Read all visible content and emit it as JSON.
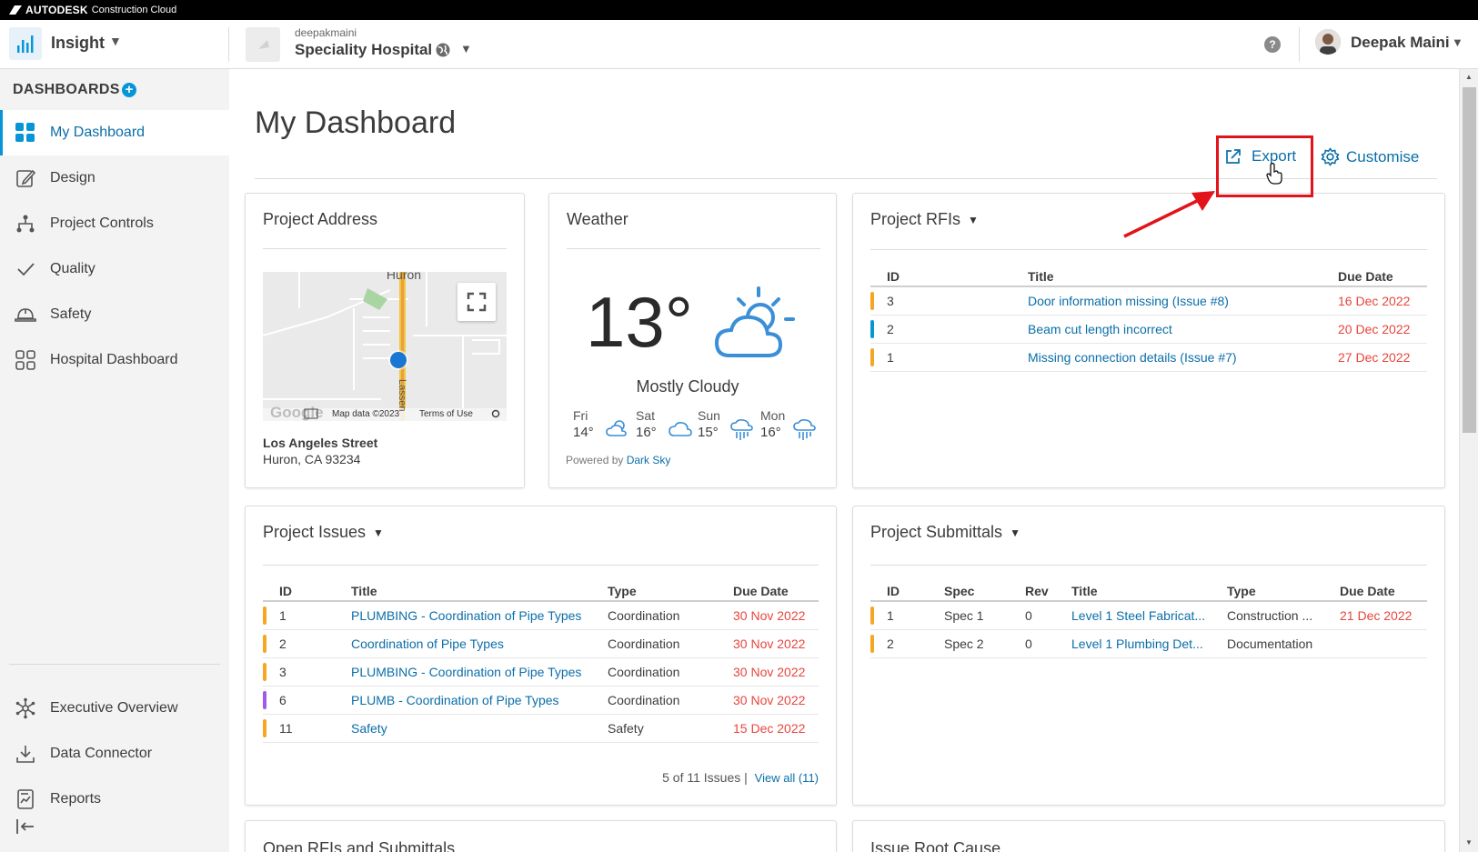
{
  "brand": {
    "name": "AUTODESK",
    "product": "Construction Cloud"
  },
  "header": {
    "app_name": "Insight",
    "account": "deepakmaini",
    "project": "Speciality Hospital",
    "user": "Deepak Maini"
  },
  "sidebar": {
    "title": "DASHBOARDS",
    "items": [
      {
        "label": "My Dashboard",
        "icon": "grid-icon",
        "active": true
      },
      {
        "label": "Design",
        "icon": "edit-icon"
      },
      {
        "label": "Project Controls",
        "icon": "hierarchy-icon"
      },
      {
        "label": "Quality",
        "icon": "checkmark-icon"
      },
      {
        "label": "Safety",
        "icon": "hardhat-icon"
      },
      {
        "label": "Hospital Dashboard",
        "icon": "grid-outline-icon"
      }
    ],
    "bottom_items": [
      {
        "label": "Executive Overview",
        "icon": "network-icon"
      },
      {
        "label": "Data Connector",
        "icon": "download-icon"
      },
      {
        "label": "Reports",
        "icon": "report-icon"
      }
    ]
  },
  "main": {
    "title": "My Dashboard",
    "export_label": "Export",
    "customise_label": "Customise"
  },
  "address_card": {
    "title": "Project Address",
    "street": "Los Angeles Street",
    "city": "Huron, CA 93234",
    "map_label_top": "Huron",
    "map_street": "Lassen",
    "map_data": "Map data ©2023",
    "terms": "Terms of Use",
    "google": "Google"
  },
  "weather_card": {
    "title": "Weather",
    "temp": "13°",
    "condition": "Mostly Cloudy",
    "forecast": [
      {
        "day": "Fri",
        "temp": "14°",
        "icon": "partly-cloudy-icon"
      },
      {
        "day": "Sat",
        "temp": "16°",
        "icon": "cloud-icon"
      },
      {
        "day": "Sun",
        "temp": "15°",
        "icon": "rain-icon"
      },
      {
        "day": "Mon",
        "temp": "16°",
        "icon": "rain-icon"
      }
    ],
    "powered_by": "Powered by",
    "powered_link": "Dark Sky"
  },
  "rfis_card": {
    "title": "Project RFIs",
    "columns": [
      "ID",
      "Title",
      "Due Date"
    ],
    "rows": [
      {
        "id": "3",
        "title": "Door information missing (Issue #8)",
        "due": "16 Dec 2022",
        "flag": "#f5a623"
      },
      {
        "id": "2",
        "title": "Beam cut length incorrect",
        "due": "20 Dec 2022",
        "flag": "#0696d7"
      },
      {
        "id": "1",
        "title": "Missing connection details (Issue #7)",
        "due": "27 Dec 2022",
        "flag": "#f5a623"
      }
    ]
  },
  "issues_card": {
    "title": "Project Issues",
    "columns": [
      "ID",
      "Title",
      "Type",
      "Due Date"
    ],
    "rows": [
      {
        "id": "1",
        "title": "PLUMBING - Coordination of Pipe Types",
        "type": "Coordination",
        "due": "30 Nov 2022",
        "flag": "#f5a623"
      },
      {
        "id": "2",
        "title": "Coordination of Pipe Types",
        "type": "Coordination",
        "due": "30 Nov 2022",
        "flag": "#f5a623"
      },
      {
        "id": "3",
        "title": "PLUMBING - Coordination of Pipe Types",
        "type": "Coordination",
        "due": "30 Nov 2022",
        "flag": "#f5a623"
      },
      {
        "id": "6",
        "title": "PLUMB - Coordination of Pipe Types",
        "type": "Coordination",
        "due": "30 Nov 2022",
        "flag": "#a05ce8"
      },
      {
        "id": "11",
        "title": "Safety",
        "type": "Safety",
        "due": "15 Dec 2022",
        "flag": "#f5a623"
      }
    ],
    "summary": "5 of 11 Issues |",
    "view_all": "View all (11)"
  },
  "submittals_card": {
    "title": "Project Submittals",
    "columns": [
      "ID",
      "Spec",
      "Rev",
      "Title",
      "Type",
      "Due Date"
    ],
    "rows": [
      {
        "id": "1",
        "spec": "Spec 1",
        "rev": "0",
        "title": "Level 1 Steel Fabricat...",
        "type": "Construction ...",
        "due": "21 Dec 2022",
        "flag": "#f5a623"
      },
      {
        "id": "2",
        "spec": "Spec 2",
        "rev": "0",
        "title": "Level 1 Plumbing Det...",
        "type": "Documentation",
        "due": "",
        "flag": "#f5a623"
      }
    ]
  },
  "lower_cards": {
    "left_title": "Open RFIs and Submittals",
    "right_title": "Issue Root Cause"
  },
  "colors": {
    "accent": "#0696d7",
    "link": "#0b6ea8",
    "overdue": "#e8453c",
    "highlight": "#e2131b"
  }
}
